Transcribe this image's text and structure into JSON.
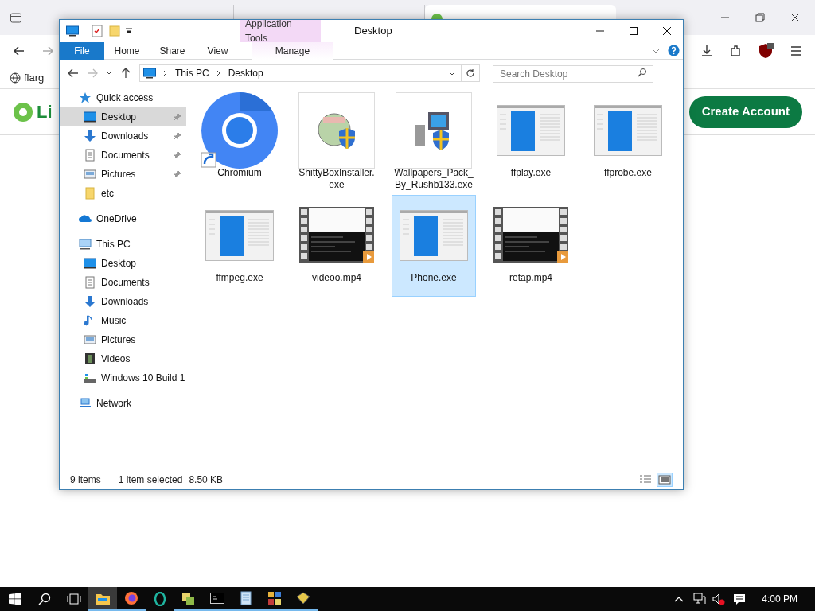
{
  "browser": {
    "tabs": [
      {
        "selected": false
      },
      {
        "selected": false
      },
      {
        "selected": true
      }
    ],
    "bookmarks": [
      "flarg"
    ],
    "page": {
      "logo_text": "Li",
      "button": "Create Account"
    }
  },
  "window": {
    "title": "Desktop",
    "context_group": "Application Tools",
    "ribbon_tabs": [
      {
        "label": "File",
        "kind": "file",
        "selected": false
      },
      {
        "label": "Home",
        "kind": "tab",
        "selected": false
      },
      {
        "label": "Share",
        "kind": "tab",
        "selected": false
      },
      {
        "label": "View",
        "kind": "tab",
        "selected": false
      },
      {
        "label": "Manage",
        "kind": "context",
        "selected": false
      }
    ],
    "address": [
      "This PC",
      "Desktop"
    ],
    "search": {
      "placeholder": "Search Desktop"
    },
    "sidebar": [
      {
        "label": "Quick access",
        "kind": "star",
        "selected": false,
        "children": [
          {
            "label": "Desktop",
            "kind": "desktop",
            "selected": true,
            "pinned": true
          },
          {
            "label": "Downloads",
            "kind": "download",
            "selected": false,
            "pinned": true
          },
          {
            "label": "Documents",
            "kind": "document",
            "selected": false,
            "pinned": true
          },
          {
            "label": "Pictures",
            "kind": "pictures",
            "selected": false,
            "pinned": true
          },
          {
            "label": "etc",
            "kind": "folder",
            "selected": false,
            "pinned": false
          }
        ]
      },
      {
        "label": "OneDrive",
        "kind": "cloud",
        "selected": false
      },
      {
        "label": "This PC",
        "kind": "pc",
        "selected": false,
        "children": [
          {
            "label": "Desktop",
            "kind": "desktop",
            "selected": false
          },
          {
            "label": "Documents",
            "kind": "document",
            "selected": false
          },
          {
            "label": "Downloads",
            "kind": "download",
            "selected": false
          },
          {
            "label": "Music",
            "kind": "music",
            "selected": false
          },
          {
            "label": "Pictures",
            "kind": "pictures",
            "selected": false
          },
          {
            "label": "Videos",
            "kind": "videos",
            "selected": false
          },
          {
            "label": "Windows 10 Build 1",
            "kind": "drive",
            "selected": false
          }
        ]
      },
      {
        "label": "Network",
        "kind": "network",
        "selected": false
      }
    ],
    "files": [
      {
        "name": "Chromium",
        "kind": "shortcut",
        "selected": false
      },
      {
        "name": "ShittyBoxInstaller.\nexe",
        "kind": "installer",
        "selected": false
      },
      {
        "name": "Wallpapers_Pack_\nBy_Rushb133.exe",
        "kind": "setup",
        "selected": false
      },
      {
        "name": "ffplay.exe",
        "kind": "app",
        "selected": false
      },
      {
        "name": "ffprobe.exe",
        "kind": "app",
        "selected": false
      },
      {
        "name": "ffmpeg.exe",
        "kind": "app",
        "selected": false
      },
      {
        "name": "videoo.mp4",
        "kind": "video",
        "selected": false
      },
      {
        "name": "Phone.exe",
        "kind": "app",
        "selected": true
      },
      {
        "name": "retap.mp4",
        "kind": "video",
        "selected": false
      }
    ],
    "status_bar": {
      "count": "9 items",
      "selection": "1 item selected",
      "size": "8.50 KB",
      "views": [
        {
          "kind": "details",
          "selected": false
        },
        {
          "kind": "large",
          "selected": true
        }
      ]
    }
  },
  "taskbar": {
    "clock": "4:00 PM"
  }
}
